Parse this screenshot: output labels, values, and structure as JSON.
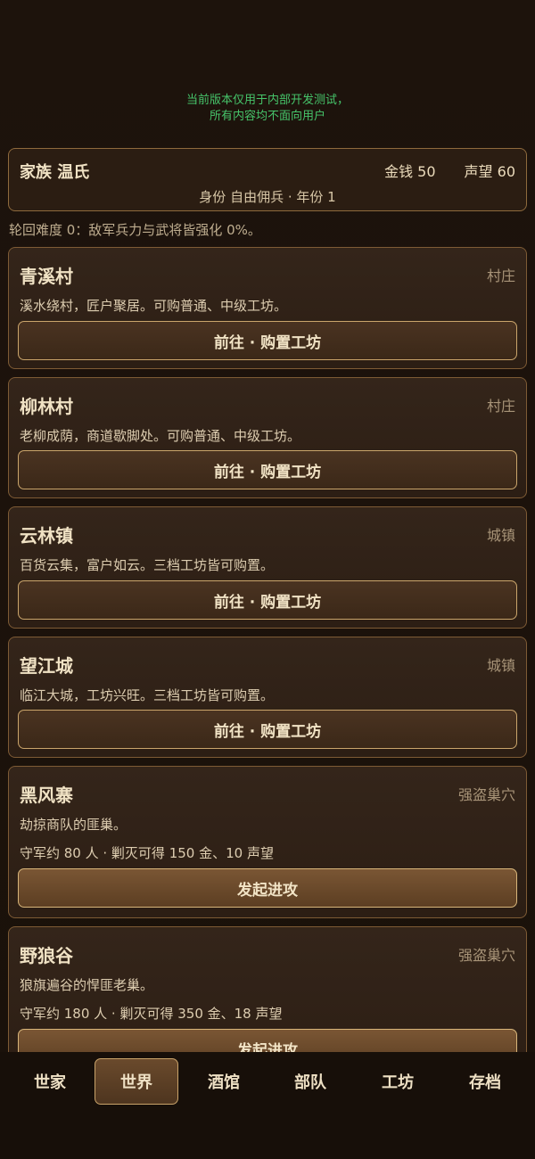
{
  "notice": {
    "line1": "当前版本仅用于内部开发测试，",
    "line2": "所有内容均不面向用户"
  },
  "header": {
    "family": "家族 温氏",
    "money": "金钱 50",
    "reputation": "声望 60",
    "identity": "身份 自由佣兵 · 年份 1"
  },
  "difficulty": "轮回难度 0：敌军兵力与武将皆强化 0%。",
  "locations": [
    {
      "name": "青溪村",
      "type": "村庄",
      "desc": "溪水绕村，匠户聚居。可购普通、中级工坊。",
      "action": "前往 · 购置工坊"
    },
    {
      "name": "柳林村",
      "type": "村庄",
      "desc": "老柳成荫，商道歇脚处。可购普通、中级工坊。",
      "action": "前往 · 购置工坊"
    },
    {
      "name": "云林镇",
      "type": "城镇",
      "desc": "百货云集，富户如云。三档工坊皆可购置。",
      "action": "前往 · 购置工坊"
    },
    {
      "name": "望江城",
      "type": "城镇",
      "desc": "临江大城，工坊兴旺。三档工坊皆可购置。",
      "action": "前往 · 购置工坊"
    },
    {
      "name": "黑风寨",
      "type": "强盗巢穴",
      "desc": "劫掠商队的匪巢。",
      "garrison": "守军约 80 人 · 剿灭可得 150 金、10 声望",
      "action": "发起进攻"
    },
    {
      "name": "野狼谷",
      "type": "强盗巢穴",
      "desc": "狼旗遍谷的悍匪老巢。",
      "garrison": "守军约 180 人 · 剿灭可得 350 金、18 声望",
      "action": "发起进攻"
    }
  ],
  "tabs": [
    "世家",
    "世界",
    "酒馆",
    "部队",
    "工坊",
    "存档"
  ],
  "colors": {
    "accent": "#c9a36a",
    "notice": "#46c46a",
    "background": "#1c120b"
  }
}
